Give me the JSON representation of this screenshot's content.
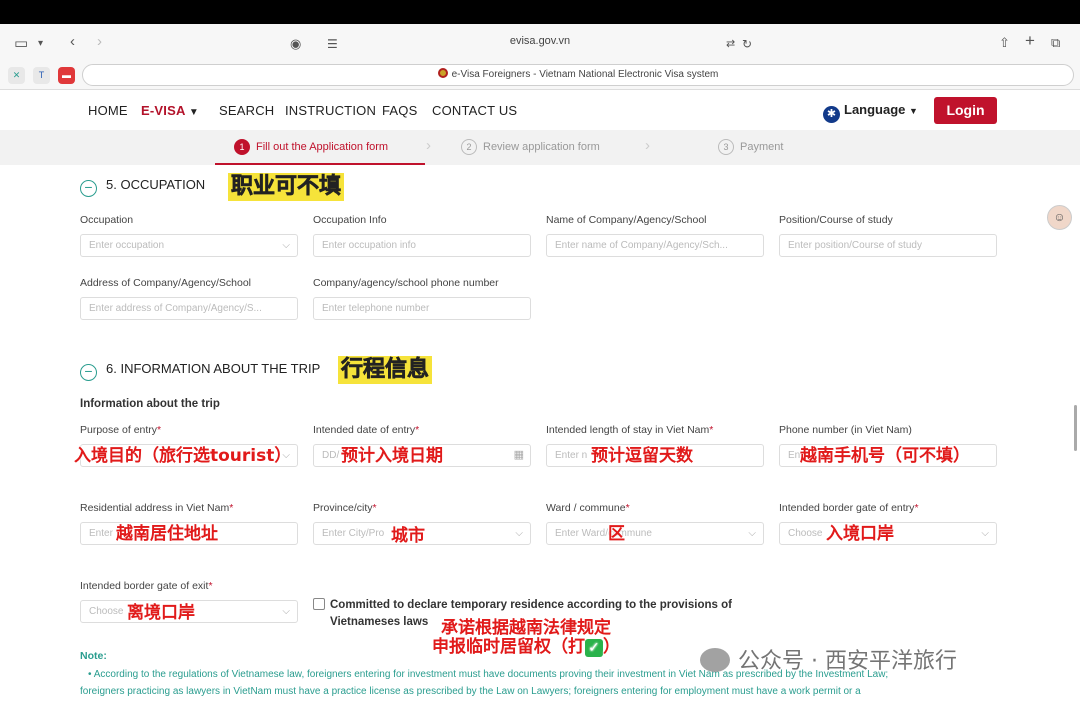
{
  "browser": {
    "url": "evisa.gov.vn",
    "tab_title": "e-Visa Foreigners - Vietnam National Electronic Visa system"
  },
  "nav": {
    "items": [
      "HOME",
      "E-VISA",
      "SEARCH",
      "INSTRUCTION",
      "FAQS",
      "CONTACT US"
    ],
    "language": "Language",
    "login": "Login"
  },
  "steps": [
    {
      "num": "1",
      "label": "Fill out the Application form",
      "active": true
    },
    {
      "num": "2",
      "label": "Review application form",
      "active": false
    },
    {
      "num": "3",
      "label": "Payment",
      "active": false
    }
  ],
  "section5": {
    "title": "5. OCCUPATION",
    "annotation": "职业可不填",
    "fields": [
      {
        "label": "Occupation",
        "placeholder": "Enter occupation",
        "select": true
      },
      {
        "label": "Occupation Info",
        "placeholder": "Enter occupation info"
      },
      {
        "label": "Name of Company/Agency/School",
        "placeholder": "Enter name of Company/Agency/Sch..."
      },
      {
        "label": "Position/Course of study",
        "placeholder": "Enter position/Course of study"
      },
      {
        "label": "Address of Company/Agency/School",
        "placeholder": "Enter address of Company/Agency/S..."
      },
      {
        "label": "Company/agency/school phone number",
        "placeholder": "Enter telephone number"
      }
    ]
  },
  "section6": {
    "title": "6. INFORMATION ABOUT THE TRIP",
    "annotation": "行程信息",
    "subtitle": "Information about the trip",
    "fields": [
      {
        "label": "Purpose of entry",
        "required": "*",
        "placeholder": "",
        "annotation": "入境目的（旅行选tourist）"
      },
      {
        "label": "Intended date of entry",
        "required": "*",
        "placeholder": "DD/",
        "annotation": "预计入境日期"
      },
      {
        "label": "Intended length of stay in Viet Nam",
        "required": "*",
        "placeholder": "Enter n",
        "annotation": "预计逗留天数"
      },
      {
        "label": "Phone number (in Viet Nam)",
        "required": "",
        "placeholder": "En",
        "annotation": "越南手机号（可不填）"
      },
      {
        "label": "Residential address in Viet Nam",
        "required": "*",
        "placeholder": "Enter",
        "annotation": "越南居住地址"
      },
      {
        "label": "Province/city",
        "required": "*",
        "placeholder": "Enter City/Pro",
        "annotation": "城市"
      },
      {
        "label": "Ward / commune",
        "required": "*",
        "placeholder": "Enter Ward/commune",
        "annotation": "区"
      },
      {
        "label": "Intended border gate of entry",
        "required": "*",
        "placeholder": "Choose",
        "annotation": "入境口岸"
      },
      {
        "label": "Intended border gate of exit",
        "required": "*",
        "placeholder": "Choose",
        "annotation": "离境口岸"
      }
    ],
    "commitment": "Committed to declare temporary residence according to the provisions of Vietnameses laws",
    "commitment_annotation_1": "承诺根据越南法律规定",
    "commitment_annotation_2": "申报临时居留权（打",
    "commitment_annotation_3": "）"
  },
  "note": {
    "heading": "Note:",
    "text_1": "• According to the regulations of Vietnamese law, foreigners entering for investment must have documents proving their investment in Viet Nam as prescribed by the Investment Law;",
    "text_2": "foreigners practicing as lawyers in VietNam must have a practice license as prescribed by the Law on Lawyers; foreigners entering for employment must have a work permit or a"
  },
  "watermark": "公众号 · 西安平洋旅行"
}
